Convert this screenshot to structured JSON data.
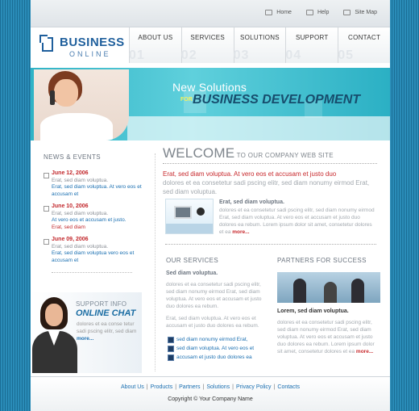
{
  "toplinks": [
    {
      "label": "Home",
      "icon": "home-icon"
    },
    {
      "label": "Help",
      "icon": "help-icon"
    },
    {
      "label": "Site Map",
      "icon": "sitemap-icon"
    }
  ],
  "logo": {
    "line1": "BUSINESS",
    "line2": "ONLINE"
  },
  "nav": [
    {
      "label": "ABOUT US",
      "num": "01"
    },
    {
      "label": "SERVICES",
      "num": "02"
    },
    {
      "label": "SOLUTIONS",
      "num": "03"
    },
    {
      "label": "SUPPORT",
      "num": "04"
    },
    {
      "label": "CONTACT",
      "num": "05"
    }
  ],
  "banner": {
    "line1": "New Solutions",
    "for": "FOR",
    "line2": "BUSINESS DEVELOPMENT"
  },
  "news": {
    "title": "NEWS & EVENTS",
    "items": [
      {
        "date": "June 12, 2006",
        "text1": "Erat, sed diam voluptua.",
        "text2": "Erat, sed diam voluptua. At vero eos et accusam et",
        "text3": ""
      },
      {
        "date": "June 10, 2006",
        "text1": "Erat, sed diam voluptua.",
        "text2": "At vero eos et accusam et justo.",
        "text3": "Erat, sed diam"
      },
      {
        "date": "June 09, 2006",
        "text1": "Erat, sed diam voluptua.",
        "text2": "Erat, sed diam voluptua vero eos et accusam et",
        "text3": ""
      }
    ]
  },
  "support": {
    "label1": "SUPPORT INFO",
    "label2": "ONLINE CHAT",
    "text": "dolores et ea conse tetur sadi pscing elitr, sed diam",
    "more": "more..."
  },
  "welcome": {
    "big": "WELCOME",
    "small": " TO OUR COMPANY WEB SITE",
    "red": "Erat, sed diam voluptua. At vero eos et accusam et justo duo",
    "gray": "dolores et ea consetetur sadi pscing elitr, sed diam nonumy eirmod Erat, sed diam voluptua.",
    "heading": "Erat, sed diam voluptua.",
    "body": "dolores et ea consetetur sadi pscing elitr, sed diam nonumy eirmod Erat, sed diam voluptua. At vero eos et accusam et justo duo dolores ea rebum. Lorem ipsum dolor sit amet, consetetur dolores et ea ",
    "more": "more..."
  },
  "services": {
    "title": "OUR SERVICES",
    "heading": "Sed diam voluptua.",
    "text1": "dolores et ea consetetur sadi pscing elitr, sed diam nonumy eirmod Erat, sed diam voluptua. At vero eos et accusam et justo duo dolores ea rebum.",
    "text2": "Erat, sed diam voluptua. At vero eos et accusam et justo duo dolores ea rebum.",
    "list": [
      "sed diam nonumy eirmod Erat,",
      "sed diam voluptua. At vero eos et",
      "accusam et justo duo dolores ea"
    ]
  },
  "partners": {
    "title": "PARTNERS FOR SUCCESS",
    "heading": "Lorem, sed diam voluptua.",
    "text": "dolores et ea consetetur sadi pscing elitr, sed diam nonumy eirmod Erat, sed diam voluptua. At vero eos et accusam et justo duo dolores ea rebum. Lorem ipsum dolor sit amet, consetetur dolores et ea ",
    "more": "more..."
  },
  "footer": {
    "links": [
      "About Us",
      "Products",
      "Partners",
      "Solutions",
      "Privacy Policy",
      "Contacts"
    ],
    "copyright": "Copyright © Your Company Name"
  }
}
